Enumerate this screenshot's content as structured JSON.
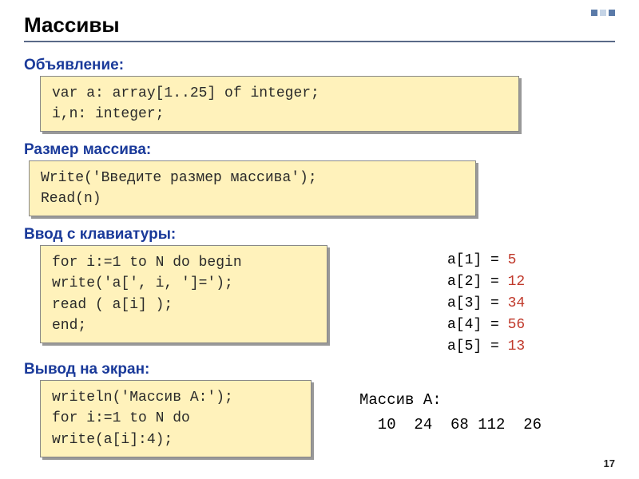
{
  "title": "Массивы",
  "sections": {
    "declaration": {
      "label": "Объявление:",
      "code": [
        "var a: array[1..25] of integer;",
        "    i,n: integer;"
      ]
    },
    "size": {
      "label": "Размер массива:",
      "code": [
        "Write('Введите размер массива');",
        "Read(n)"
      ]
    },
    "input": {
      "label": "Ввод с клавиатуры:",
      "code": [
        "for i:=1 to N do begin",
        "  write('a[', i, ']=');",
        "  read ( a[i] );",
        "end;"
      ]
    },
    "output": {
      "label": "Вывод на экран:",
      "code": [
        "writeln('Массив A:');",
        "for i:=1 to N do",
        "  write(a[i]:4);"
      ]
    }
  },
  "sample_input": [
    {
      "prompt": "a[1] =",
      "value": "5"
    },
    {
      "prompt": "a[2] =",
      "value": "12"
    },
    {
      "prompt": "a[3] =",
      "value": "34"
    },
    {
      "prompt": "a[4] =",
      "value": "56"
    },
    {
      "prompt": "a[5] =",
      "value": "13"
    }
  ],
  "sample_output": {
    "header": "Массив A:",
    "values": "  10  24  68 112  26"
  },
  "page_number": "17"
}
